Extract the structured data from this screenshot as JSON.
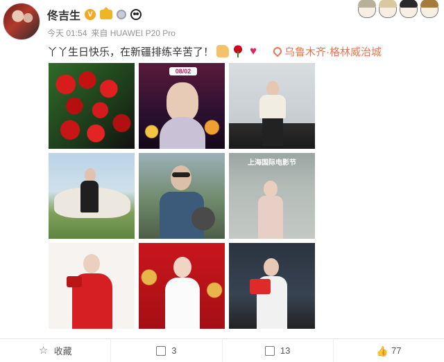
{
  "user": {
    "name": "佟吉生"
  },
  "meta": {
    "time": "今天 01:54",
    "source": "来自 HUAWEI P20 Pro"
  },
  "post": {
    "text": "丫丫生日快乐，在新疆排练辛苦了！",
    "emojis": [
      "thumbs-up-icon",
      "rose-icon",
      "heart-icon"
    ],
    "location": "乌鲁木齐·格林威治城"
  },
  "photos": [
    {
      "label": "roses-bouquet"
    },
    {
      "label": "photo-date-card",
      "caption_text": "08/02"
    },
    {
      "label": "cinema-event-photo"
    },
    {
      "label": "horse-riding-photo"
    },
    {
      "label": "pilot-helmet-photo"
    },
    {
      "label": "film-festival-photo",
      "caption_text": "上海国际电影节"
    },
    {
      "label": "red-dress-photo"
    },
    {
      "label": "red-backdrop-photo"
    },
    {
      "label": "movie-promo-photo"
    }
  ],
  "actions": {
    "favorite": "收藏",
    "share": "3",
    "comment": "13",
    "like": "77"
  },
  "colors": {
    "location": "#eb7350",
    "text": "#333333",
    "muted": "#939393"
  }
}
